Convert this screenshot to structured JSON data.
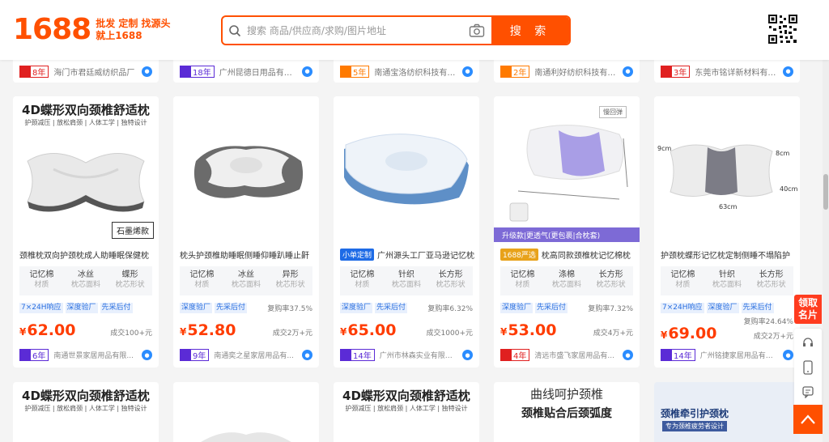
{
  "header": {
    "logo": "1688",
    "slogan_line1": "批发 定制 找源头",
    "slogan_line2": "就上1688",
    "search_placeholder": "搜索 商品/供应商/求购/图片地址",
    "search_button": "搜 索",
    "icons": {
      "search": "search-icon",
      "camera": "camera-icon",
      "qr": "qr-code-icon"
    }
  },
  "top_strip": [
    {
      "years": "8年",
      "badge": "red",
      "shop": "海门市君廷威纺织品厂"
    },
    {
      "years": "18年",
      "badge": "purple",
      "shop": "广州昆德日用品有限公..."
    },
    {
      "years": "5年",
      "badge": "orange",
      "shop": "南通宝洛纺织科技有限..."
    },
    {
      "years": "2年",
      "badge": "orange",
      "shop": "南通利好纺织科技有限..."
    },
    {
      "years": "3年",
      "badge": "red",
      "shop": "东莞市铭详新材料有限..."
    }
  ],
  "products": [
    {
      "img_title": "4D蝶形双向颈椎舒适枕",
      "img_sub": "护颈减压 | 放松肩颈 | 人体工学 | 独特设计",
      "img_tag": "石墨烯款",
      "title": "颈椎枕双向护颈枕成人助睡眠保健枕",
      "specs": [
        {
          "v": "记忆棉",
          "l": "材质"
        },
        {
          "v": "冰丝",
          "l": "枕芯面料"
        },
        {
          "v": "蝶形",
          "l": "枕芯形状"
        }
      ],
      "tags": [
        "7×24H响应",
        "深度验厂",
        "先采后付"
      ],
      "repurchase": "",
      "price": "62.00",
      "sold": "成交100+元",
      "years": "6年",
      "badge": "purple",
      "shop": "南通世景家居用品有限..."
    },
    {
      "title": "枕头护颈椎助睡眠侧睡仰睡趴睡止鼾",
      "specs": [
        {
          "v": "记忆棉",
          "l": "材质"
        },
        {
          "v": "冰丝",
          "l": "枕芯面料"
        },
        {
          "v": "异形",
          "l": "枕芯形状"
        }
      ],
      "tags": [
        "深度验厂",
        "先采后付"
      ],
      "repurchase": "复购率37.5%",
      "price": "52.80",
      "sold": "成交2万+元",
      "years": "9年",
      "badge": "purple",
      "shop": "南通奕之星家居用品有..."
    },
    {
      "title_tag": "小单定制",
      "title": "广州源头工厂亚马逊记忆枕",
      "specs": [
        {
          "v": "记忆棉",
          "l": "材质"
        },
        {
          "v": "针织",
          "l": "枕芯面料"
        },
        {
          "v": "长方形",
          "l": "枕芯形状"
        }
      ],
      "tags": [
        "深度验厂",
        "先采后付"
      ],
      "repurchase": "复购率6.32%",
      "price": "65.00",
      "sold": "成交1000+元",
      "years": "14年",
      "badge": "purple",
      "shop": "广州市林森实业有限公..."
    },
    {
      "img_label": "慢回弹",
      "img_banner": "升级款|更透气(更包裹|合枕套)",
      "title_tag": "1688严选",
      "title": "枕高同款颈椎枕记忆棉枕",
      "specs": [
        {
          "v": "记忆棉",
          "l": "材质"
        },
        {
          "v": "涤棉",
          "l": "枕芯面料"
        },
        {
          "v": "长方形",
          "l": "枕芯形状"
        }
      ],
      "tags": [
        "深度验厂",
        "先采后付"
      ],
      "repurchase": "复购率7.32%",
      "price": "53.00",
      "sold": "成交4万+元",
      "years": "4年",
      "badge": "red",
      "shop": "清远市盛飞家居用品有..."
    },
    {
      "img_dims": [
        "9cm",
        "8cm",
        "40cm",
        "63cm"
      ],
      "title": "护颈枕蝶形记忆枕定制侧睡不塌陷护",
      "specs": [
        {
          "v": "记忆棉",
          "l": "材质"
        },
        {
          "v": "针织",
          "l": "枕芯面料"
        },
        {
          "v": "长方形",
          "l": "枕芯形状"
        }
      ],
      "tags": [
        "7×24H响应",
        "深度验厂",
        "先采后付"
      ],
      "repurchase": "复购率24.64%",
      "price": "69.00",
      "sold": "成交2万+元",
      "years": "14年",
      "badge": "purple",
      "shop": "广州铭捷家居用品有限..."
    }
  ],
  "bottom_row": [
    {
      "title": "4D蝶形双向颈椎舒适枕",
      "sub": "护颈减压 | 放松肩颈 | 人体工学 | 独特设计"
    },
    {
      "title": "",
      "sub": ""
    },
    {
      "title": "4D蝶形双向颈椎舒适枕",
      "sub": "护颈减压 | 放松肩颈 | 人体工学 | 独特设计"
    },
    {
      "title": "曲线呵护颈椎",
      "sub": "颈椎贴合后颈弧度"
    },
    {
      "title": "颈椎牵引护颈枕",
      "sub": "专为颈椎疲劳者设计"
    }
  ],
  "sidebar": {
    "lingqu_line1": "领取",
    "lingqu_line2": "名片"
  },
  "colors": {
    "brand": "#ff5000",
    "price": "#ff3c00",
    "tag_blue": "#2a6fe0"
  },
  "currency": "¥"
}
